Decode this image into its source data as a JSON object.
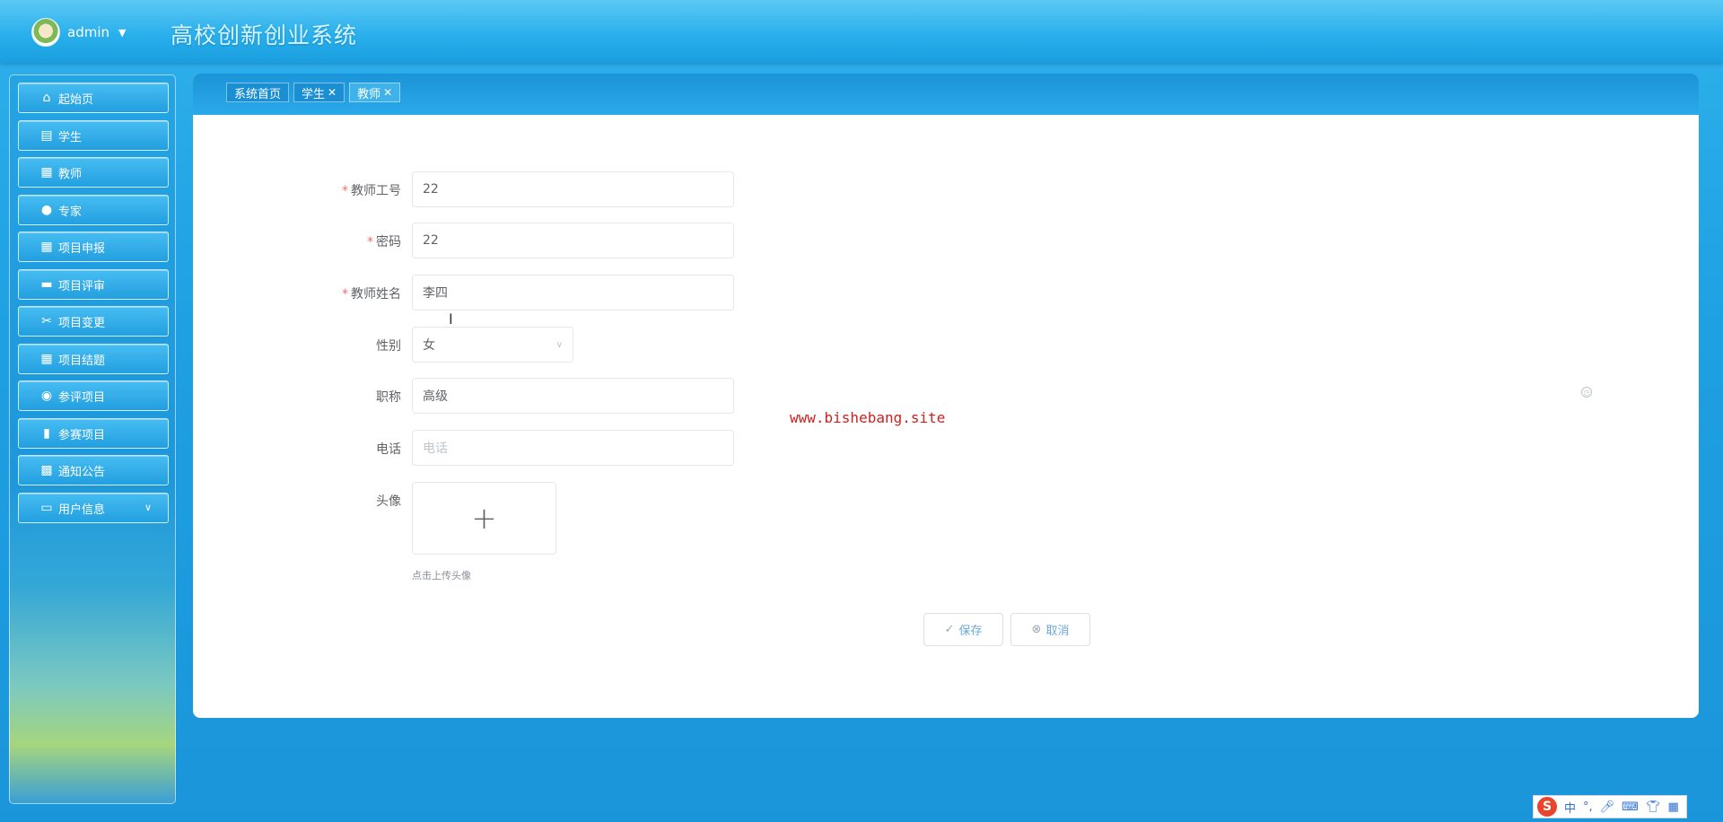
{
  "header": {
    "user_name": "admin",
    "title": "高校创新创业系统"
  },
  "sidebar": {
    "items": [
      {
        "label": "起始页",
        "icon": "home-icon"
      },
      {
        "label": "学生",
        "icon": "chat-icon"
      },
      {
        "label": "教师",
        "icon": "grid-icon"
      },
      {
        "label": "专家",
        "icon": "user-icon"
      },
      {
        "label": "项目申报",
        "icon": "grid-icon"
      },
      {
        "label": "项目评审",
        "icon": "briefcase-icon"
      },
      {
        "label": "项目变更",
        "icon": "ticket-icon"
      },
      {
        "label": "项目结题",
        "icon": "grid-icon"
      },
      {
        "label": "参评项目",
        "icon": "lightbulb-icon"
      },
      {
        "label": "参赛项目",
        "icon": "bar-chart-icon"
      },
      {
        "label": "通知公告",
        "icon": "table-icon"
      },
      {
        "label": "用户信息",
        "icon": "card-icon"
      }
    ]
  },
  "tabs": [
    {
      "label": "系统首页",
      "closable": false,
      "active": false
    },
    {
      "label": "学生",
      "closable": true,
      "active": false
    },
    {
      "label": "教师",
      "closable": true,
      "active": true
    }
  ],
  "form": {
    "teacher_id": {
      "label": "教师工号",
      "value": "22",
      "required": true
    },
    "password": {
      "label": "密码",
      "value": "22",
      "required": true
    },
    "teacher_name": {
      "label": "教师姓名",
      "value": "李四",
      "required": true
    },
    "gender": {
      "label": "性别",
      "value": "女"
    },
    "title": {
      "label": "职称",
      "value": "高级"
    },
    "phone": {
      "label": "电话",
      "value": "",
      "placeholder": "电话"
    },
    "avatar": {
      "label": "头像",
      "tip": "点击上传头像"
    }
  },
  "buttons": {
    "save": "保存",
    "cancel": "取消"
  },
  "watermark": "www.bishebang.site",
  "ime": {
    "mode": "中"
  },
  "colors": {
    "primary_blue": "#1ea0e2",
    "required": "#f56c6c"
  }
}
